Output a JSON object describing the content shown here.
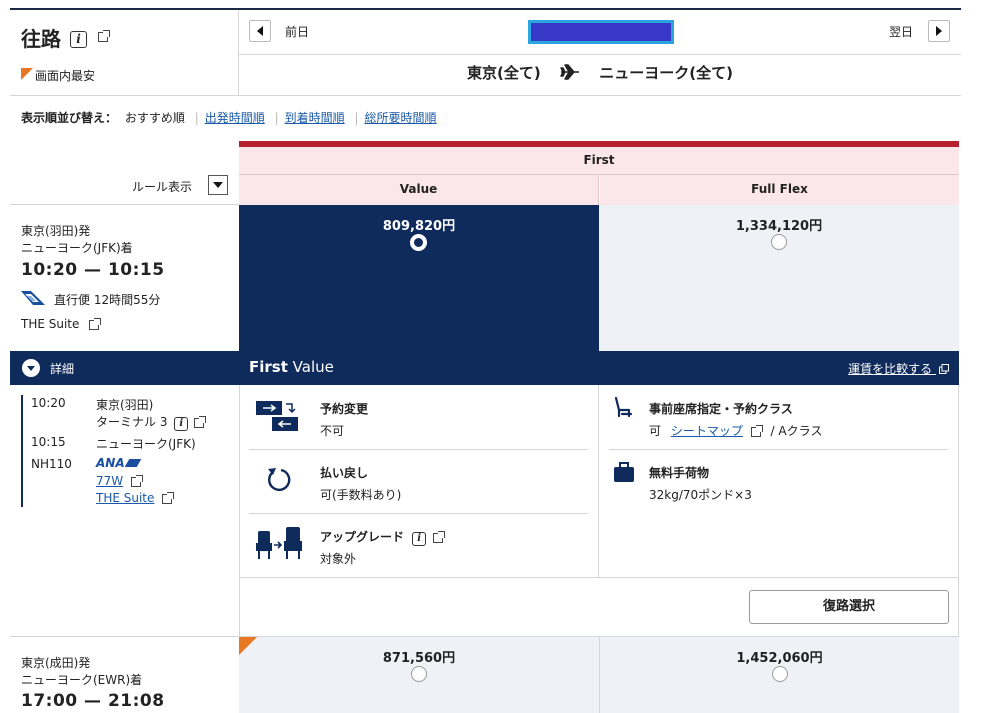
{
  "header": {
    "title": "往路",
    "cheapest_label": "画面内最安",
    "prev_day": "前日",
    "next_day": "翌日",
    "route_from": "東京(全て)",
    "route_to": "ニューヨーク(全て)"
  },
  "sort": {
    "label": "表示順並び替え：",
    "current": "おすすめ順",
    "options": [
      "出発時間順",
      "到着時間順",
      "総所要時間順"
    ]
  },
  "fare_header": {
    "cabin": "First",
    "columns": [
      "Value",
      "Full Flex"
    ],
    "rules_label": "ルール表示"
  },
  "flight1": {
    "departure": "東京(羽田)発",
    "arrival": "ニューヨーク(JFK)着",
    "times": "10:20 — 10:15",
    "duration": "直行便 12時間55分",
    "product": "THE Suite",
    "price_value": "809,820円",
    "price_flex": "1,334,120円"
  },
  "details": {
    "toggle_label": "詳細",
    "fare_name_bold": "First",
    "fare_name": "Value",
    "compare_link": "運賃を比較する",
    "segment": {
      "dep_time": "10:20",
      "dep_place": "東京(羽田)",
      "dep_terminal": "ターミナル 3",
      "arr_time": "10:15",
      "arr_place": "ニューヨーク(JFK)",
      "flight_no": "NH110",
      "airline": "ANA",
      "aircraft": "77W",
      "product": "THE Suite"
    },
    "conditions": [
      {
        "title": "予約変更",
        "value": "不可",
        "icon": "ticket-change-icon"
      },
      {
        "title": "払い戻し",
        "value": "可(手数料あり)",
        "icon": "refund-icon"
      },
      {
        "title": "アップグレード",
        "value": "対象外",
        "icon": "upgrade-seat-icon"
      }
    ],
    "seat": {
      "title": "事前座席指定・予約クラス",
      "value_prefix": "可",
      "seatmap_link": "シートマップ",
      "class_text": "/ Aクラス",
      "icon": "seat-icon"
    },
    "baggage": {
      "title": "無料手荷物",
      "value": "32kg/70ポンド×3",
      "icon": "baggage-icon"
    },
    "return_button": "復路選択"
  },
  "flight2": {
    "departure": "東京(成田)発",
    "arrival": "ニューヨーク(EWR)着",
    "times": "17:00 — 21:08",
    "price_value": "871,560円",
    "price_flex": "1,452,060円"
  },
  "colors": {
    "navy": "#0e2b5c",
    "cabin_red": "#b7202e",
    "header_pink": "#fbe7ea",
    "link_blue": "#1a5aa8",
    "cheapest_orange": "#e87722"
  }
}
